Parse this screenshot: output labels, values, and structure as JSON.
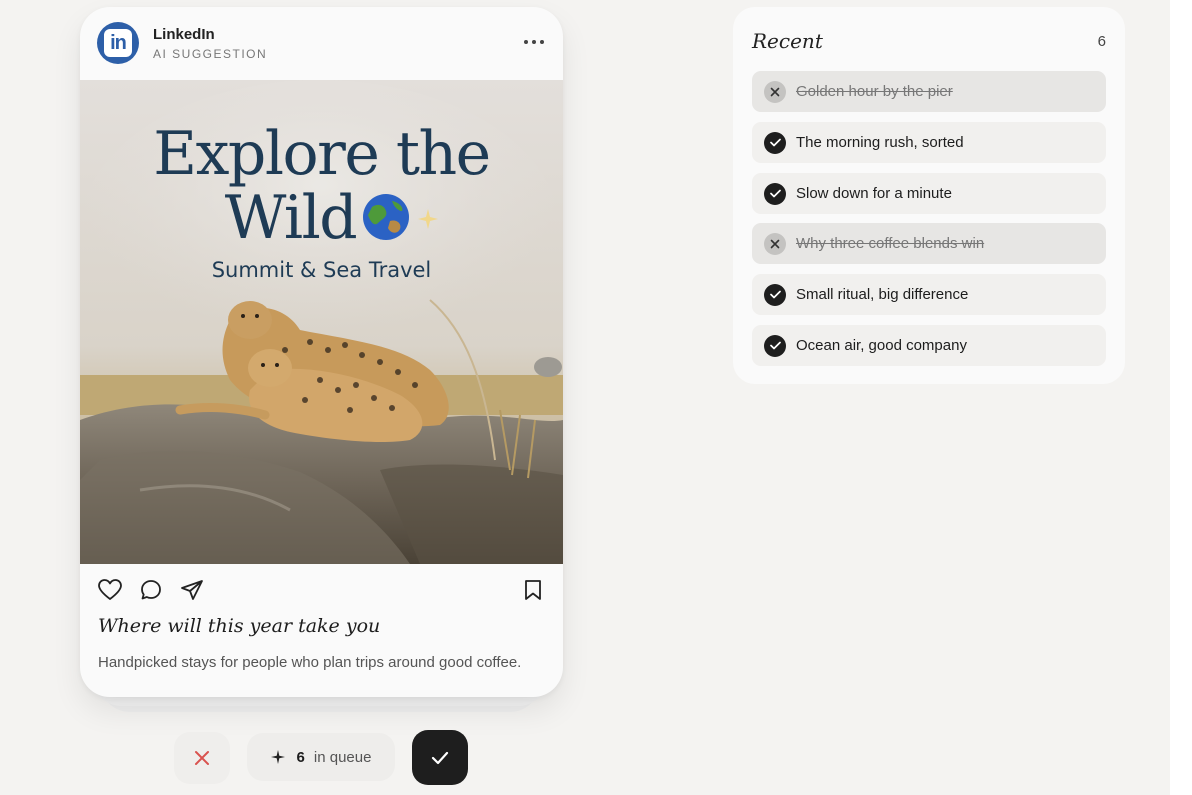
{
  "post": {
    "account_name": "LinkedIn",
    "account_sub": "AI SUGGESTION",
    "avatar_letters": "in",
    "image": {
      "headline_line1": "Explore the",
      "headline_line2": "Wild",
      "subtitle": "Summit & Sea Travel"
    },
    "caption_title": "Where will this year take you",
    "caption_body": "Handpicked stays for people who plan trips around good coffee."
  },
  "controls": {
    "queue_count": "6",
    "queue_label": "in queue"
  },
  "recent": {
    "title": "Recent",
    "count": "6",
    "items": [
      {
        "label": "Golden hour by the pier",
        "status": "rejected"
      },
      {
        "label": "The morning rush, sorted",
        "status": "approved"
      },
      {
        "label": "Slow down for a minute",
        "status": "approved"
      },
      {
        "label": "Why three coffee blends win",
        "status": "rejected"
      },
      {
        "label": "Small ritual, big difference",
        "status": "approved"
      },
      {
        "label": "Ocean air, good company",
        "status": "approved"
      }
    ]
  },
  "colors": {
    "background": "#f4f3f1",
    "headline": "#1e3b55",
    "linkedin_blue": "#2d5fa8",
    "reject_red": "#d9534f",
    "approve_dark": "#1e1e1e"
  }
}
